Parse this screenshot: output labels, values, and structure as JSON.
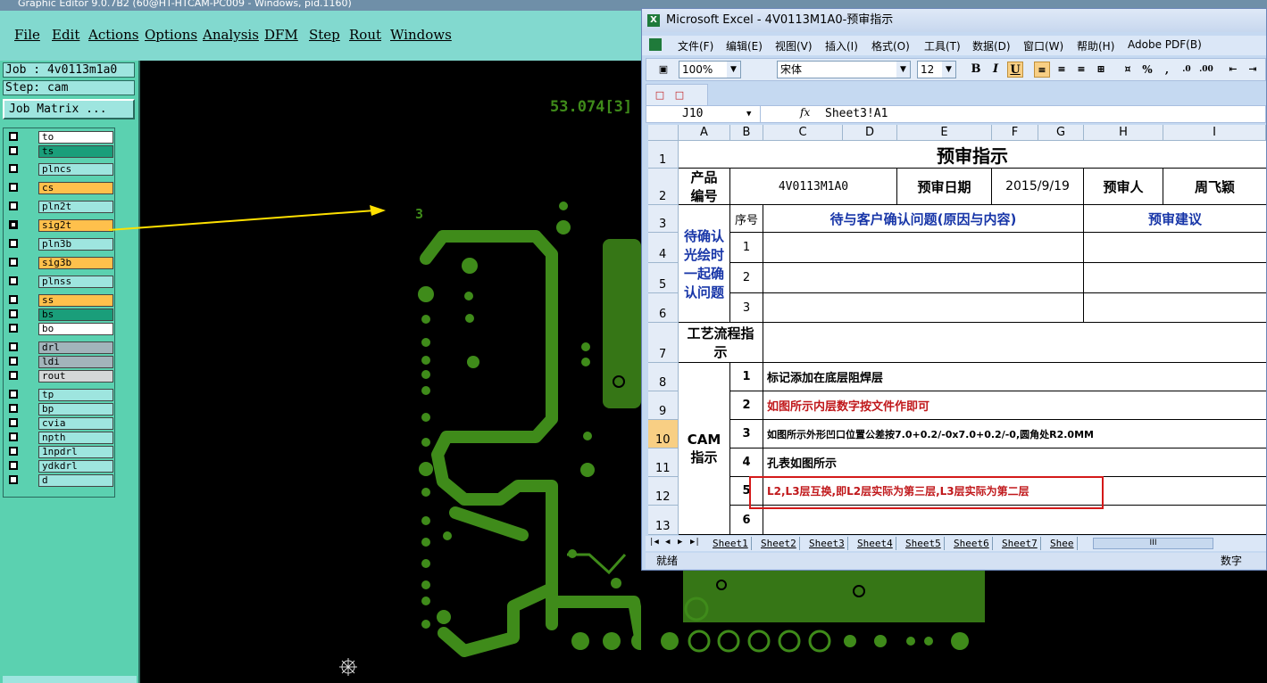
{
  "cam": {
    "title": "Graphic Editor 9.0.7B2 (60@HT-HTCAM-PC009 - Windows, pid.1160)",
    "menu": [
      "File",
      "Edit",
      "Actions",
      "Options",
      "Analysis",
      "DFM",
      "Step",
      "Rout",
      "Windows"
    ],
    "job_label": "Job : 4v0113m1a0",
    "step_label": "Step: cam",
    "job_matrix_button": "Job Matrix ...",
    "layers": [
      {
        "name": "to",
        "color": "#ffffff",
        "checked": false
      },
      {
        "name": "ts",
        "color": "#1a9e7a",
        "checked": false
      },
      {
        "name": "plncs",
        "color": "#9ee5df",
        "checked": false
      },
      {
        "name": "cs",
        "color": "#ffc04c",
        "checked": false
      },
      {
        "name": "pln2t",
        "color": "#9ee5df",
        "checked": false
      },
      {
        "name": "sig2t",
        "color": "#ffc04c",
        "checked": true
      },
      {
        "name": "pln3b",
        "color": "#9ee5df",
        "checked": false
      },
      {
        "name": "sig3b",
        "color": "#ffc04c",
        "checked": false
      },
      {
        "name": "plnss",
        "color": "#9ee5df",
        "checked": false
      },
      {
        "name": "ss",
        "color": "#ffc04c",
        "checked": false
      },
      {
        "name": "bs",
        "color": "#1a9e7a",
        "checked": false
      },
      {
        "name": "bo",
        "color": "#ffffff",
        "checked": false
      },
      {
        "name": "drl",
        "color": "#a2b4bb",
        "checked": false
      },
      {
        "name": "ldi",
        "color": "#a2b4bb",
        "checked": false
      },
      {
        "name": "rout",
        "color": "#d4d8d8",
        "checked": false
      },
      {
        "name": "tp",
        "color": "#9ee5df",
        "checked": false
      },
      {
        "name": "bp",
        "color": "#9ee5df",
        "checked": false
      },
      {
        "name": "cvia",
        "color": "#9ee5df",
        "checked": false
      },
      {
        "name": "npth",
        "color": "#9ee5df",
        "checked": false
      },
      {
        "name": "1npdrl",
        "color": "#9ee5df",
        "checked": false
      },
      {
        "name": "ydkdrl",
        "color": "#9ee5df",
        "checked": false
      },
      {
        "name": "d",
        "color": "#9ee5df",
        "checked": false
      }
    ],
    "pcb_coordinate": "53.074[3]",
    "pcb_layer_digit": "3",
    "trace_color": "#3f8b1a",
    "arrow_color": "#ffe000"
  },
  "excel": {
    "title": "Microsoft Excel - 4V0113M1A0-预审指示",
    "menu": [
      "文件(F)",
      "编辑(E)",
      "视图(V)",
      "插入(I)",
      "格式(O)",
      "工具(T)",
      "数据(D)",
      "窗口(W)",
      "帮助(H)",
      "Adobe PDF(B)"
    ],
    "zoom": "100%",
    "font_name": "宋体",
    "font_size": "12",
    "name_box": "J10",
    "formula": "Sheet3!A1",
    "fx_label": "fx",
    "columns": [
      "A",
      "B",
      "C",
      "D",
      "E",
      "F",
      "G",
      "H",
      "I"
    ],
    "rows": [
      "1",
      "2",
      "3",
      "4",
      "5",
      "6",
      "7",
      "8",
      "9",
      "10",
      "11",
      "12",
      "13"
    ],
    "sheet_title": "预审指示",
    "product_label": "产品编号",
    "product_code": "4V0113M1A0",
    "review_date_label": "预审日期",
    "review_date": "2015/9/19",
    "reviewer_label": "预审人",
    "reviewer": "周飞颖",
    "pending_label": "待确认光绘时一起确认问题",
    "seq_label": "序号",
    "issues_header": "待与客户确认问题(原因与内容)",
    "suggest_header": "预审建议",
    "pending_numbers": [
      "1",
      "2",
      "3"
    ],
    "process_label": "工艺流程指示",
    "cam_label": "CAM指示",
    "instructions": [
      {
        "no": "1",
        "text": "标记添加在底层阻焊层",
        "style": "normal"
      },
      {
        "no": "2",
        "text": "如图所示内层数字按文件作即可",
        "style": "red"
      },
      {
        "no": "3",
        "text": "如图所示外形凹口位置公差按7.0+0.2/-0x7.0+0.2/-0,圆角处R2.0MM",
        "style": "normal"
      },
      {
        "no": "4",
        "text": "孔表如图所示",
        "style": "normal"
      },
      {
        "no": "5",
        "text": "L2,L3层互换,即L2层实际为第三层,L3层实际为第二层",
        "style": "red"
      },
      {
        "no": "6",
        "text": "",
        "style": "normal"
      }
    ],
    "sheet_tabs": [
      "Sheet1",
      "Sheet2",
      "Sheet3",
      "Sheet4",
      "Sheet5",
      "Sheet6",
      "Sheet7",
      "Shee"
    ],
    "status_left": "就绪",
    "status_right": "数字"
  }
}
